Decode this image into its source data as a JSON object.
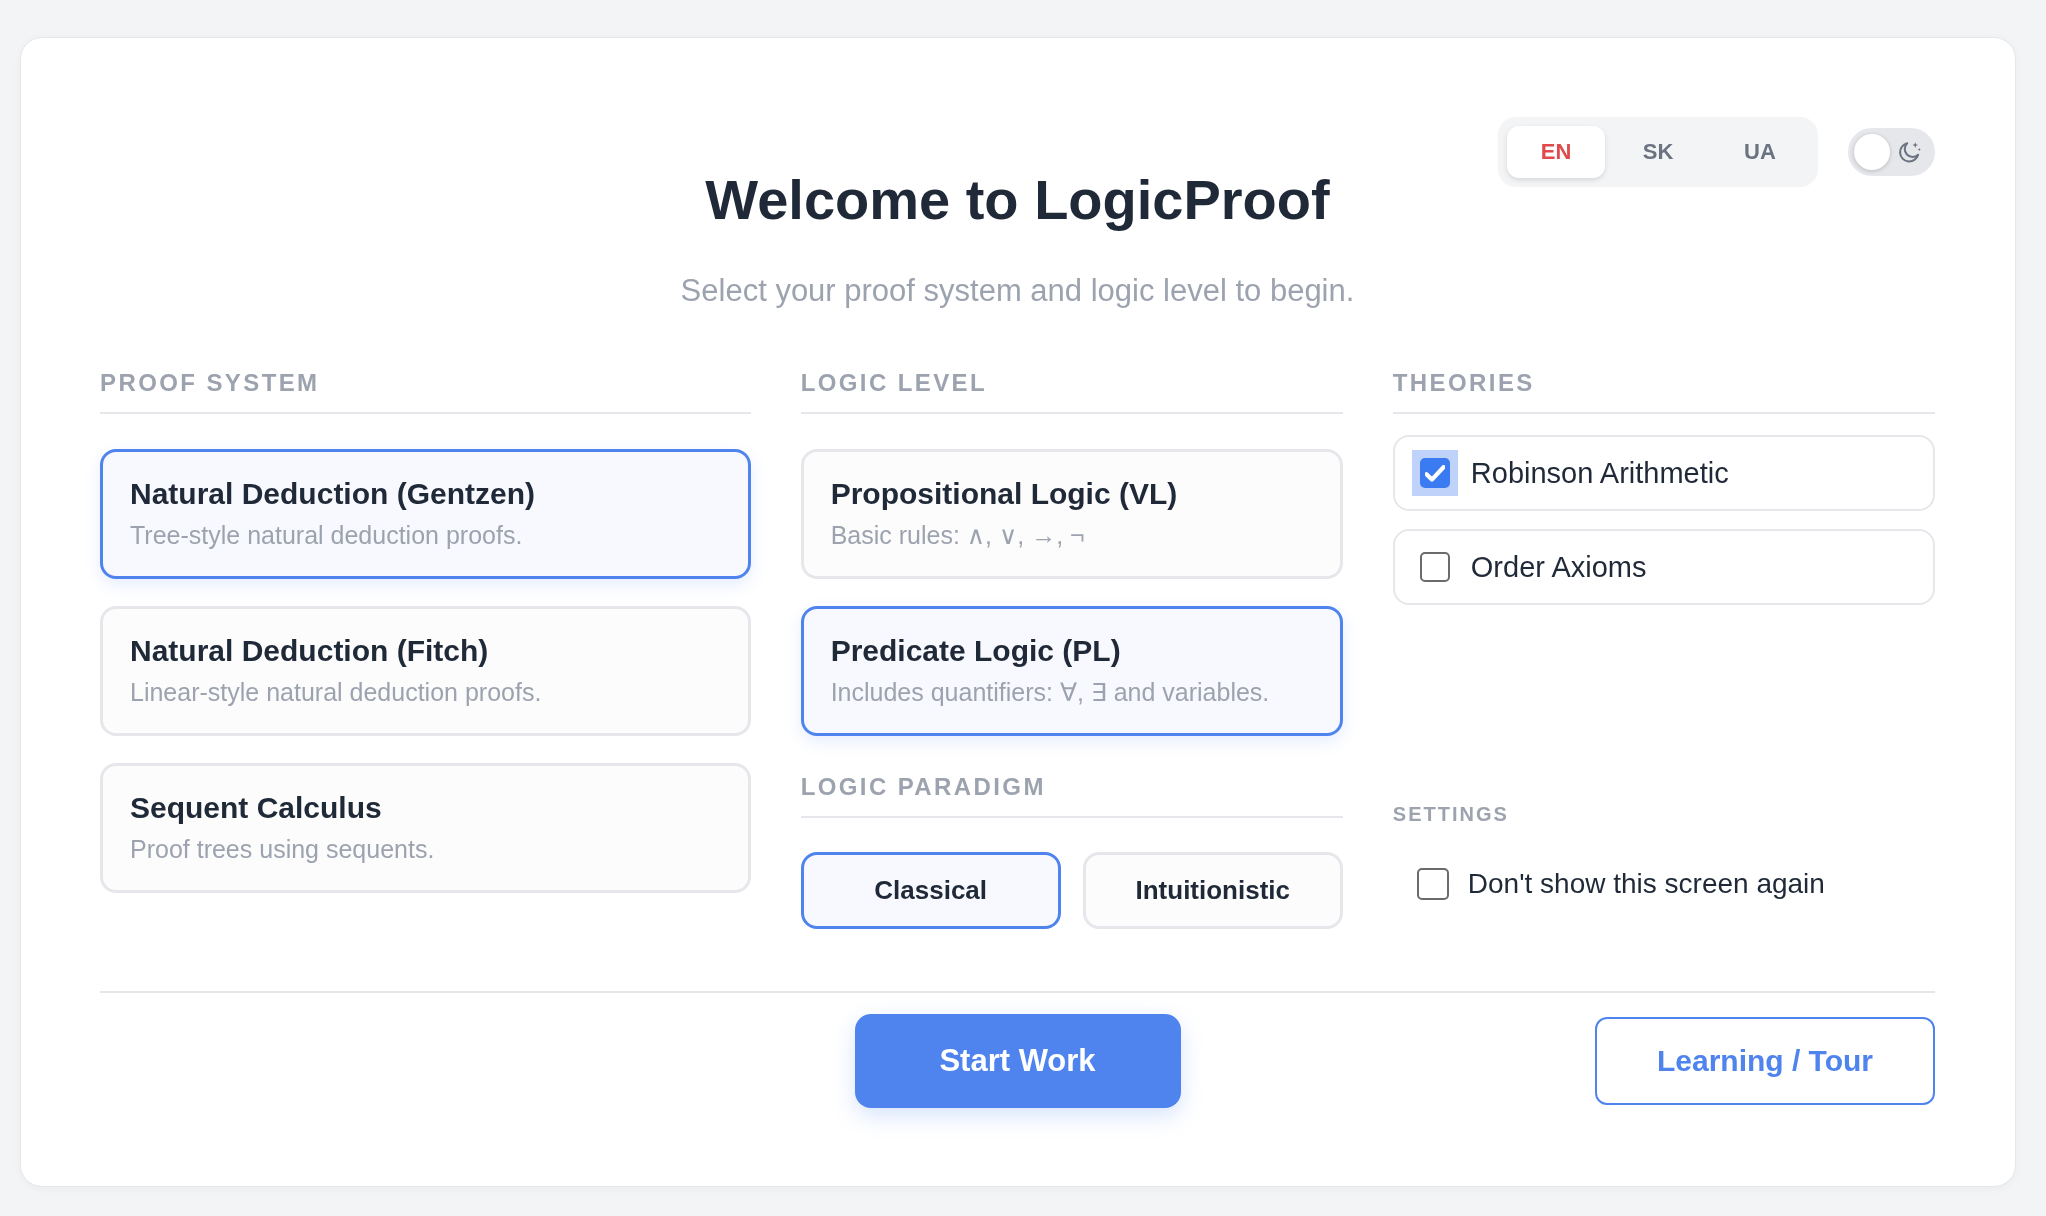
{
  "language_switch": [
    {
      "label": "EN",
      "selected": true
    },
    {
      "label": "SK",
      "selected": false
    },
    {
      "label": "UA",
      "selected": false
    }
  ],
  "theme_toggle": {
    "on": false
  },
  "title": "Welcome to LogicProof",
  "subtitle": "Select your proof system and logic level to begin.",
  "proof_system": {
    "heading": "PROOF SYSTEM",
    "options": [
      {
        "title": "Natural Deduction (Gentzen)",
        "description": "Tree-style natural deduction proofs.",
        "selected": true
      },
      {
        "title": "Natural Deduction (Fitch)",
        "description": "Linear-style natural deduction proofs.",
        "selected": false
      },
      {
        "title": "Sequent Calculus",
        "description": "Proof trees using sequents.",
        "selected": false
      }
    ]
  },
  "logic_level": {
    "heading": "LOGIC LEVEL",
    "options": [
      {
        "title": "Propositional Logic (VL)",
        "description": "Basic rules: ∧, ∨, →, ¬",
        "selected": false
      },
      {
        "title": "Predicate Logic (PL)",
        "description": "Includes quantifiers: ∀, ∃ and variables.",
        "selected": true
      }
    ]
  },
  "logic_paradigm": {
    "heading": "LOGIC PARADIGM",
    "options": [
      {
        "label": "Classical",
        "selected": true
      },
      {
        "label": "Intuitionistic",
        "selected": false
      }
    ]
  },
  "theories": {
    "heading": "THEORIES",
    "items": [
      {
        "label": "Robinson Arithmetic",
        "checked": true,
        "focused": true
      },
      {
        "label": "Order Axioms",
        "checked": false,
        "focused": false
      }
    ]
  },
  "settings": {
    "heading": "SETTINGS",
    "items": [
      {
        "label": "Don't show this screen again",
        "checked": false
      }
    ]
  },
  "footer": {
    "primary_button": "Start Work",
    "secondary_button": "Learning / Tour"
  }
}
